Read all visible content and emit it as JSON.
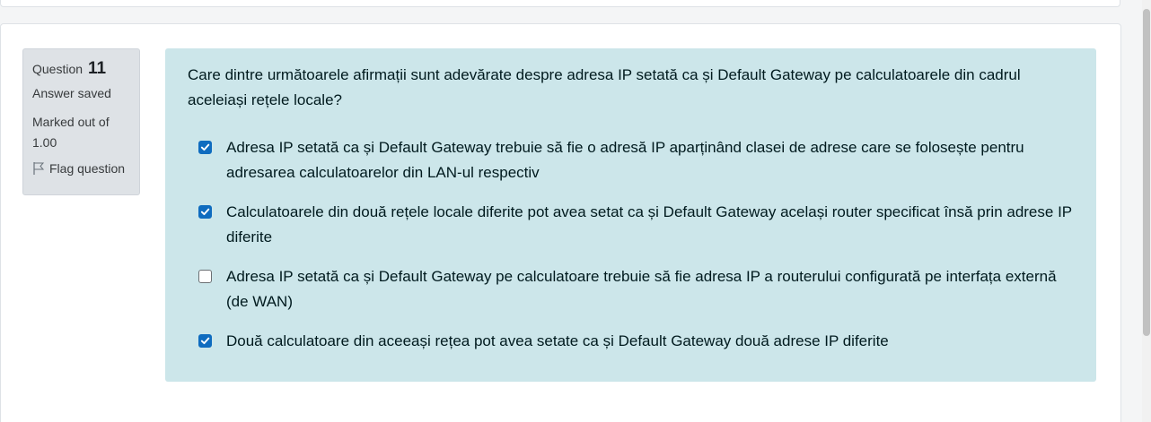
{
  "question_info": {
    "label": "Question",
    "number": "11",
    "state": "Answer saved",
    "grade": "Marked out of 1.00",
    "flag_label": "Flag question"
  },
  "question": {
    "text": "Care dintre următoarele afirmații sunt adevărate despre adresa IP setată ca și Default Gateway pe calculatoarele din cadrul aceleiași rețele locale?",
    "answers": [
      {
        "text": "Adresa IP setată ca și Default Gateway trebuie să fie o adresă IP aparținând clasei de adrese care se folosește pentru adresarea calculatoarelor din LAN-ul respectiv",
        "checked": true
      },
      {
        "text": "Calculatoarele din două rețele locale diferite pot avea setat ca și Default Gateway același router specificat însă prin adrese IP diferite",
        "checked": true
      },
      {
        "text": "Adresa IP setată ca și Default Gateway pe calculatoare trebuie să fie adresa IP a routerului configurată pe interfața externă (de WAN)",
        "checked": false
      },
      {
        "text": "Două calculatoare din aceeași rețea pot avea setate ca și Default Gateway două adrese IP diferite",
        "checked": true
      }
    ]
  },
  "colors": {
    "content_background": "#cce6ea",
    "info_background": "#dee2e6",
    "checkbox_checked": "#0f6cbf"
  },
  "icons": {
    "flag": "flag-icon",
    "check": "checkmark-icon"
  }
}
